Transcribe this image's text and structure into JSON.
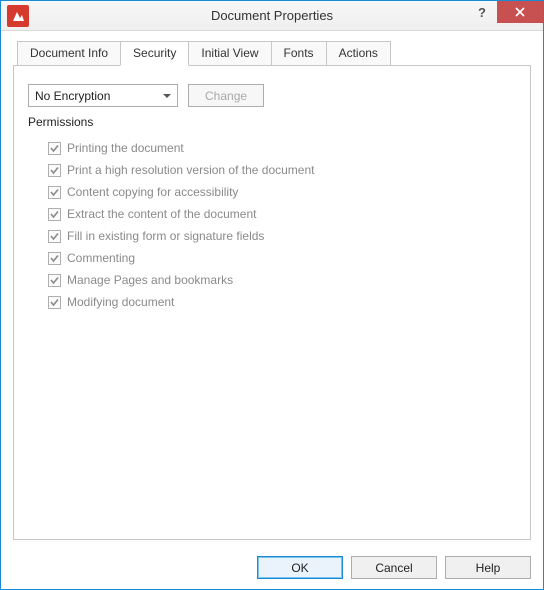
{
  "window": {
    "title": "Document Properties"
  },
  "tabs": {
    "items": [
      {
        "label": "Document Info"
      },
      {
        "label": "Security"
      },
      {
        "label": "Initial View"
      },
      {
        "label": "Fonts"
      },
      {
        "label": "Actions"
      }
    ],
    "active_index": 1
  },
  "security": {
    "encryption_selected": "No Encryption",
    "change_button": "Change",
    "permissions_label": "Permissions",
    "permissions": [
      {
        "label": "Printing the document",
        "checked": true
      },
      {
        "label": "Print a high resolution version of the document",
        "checked": true
      },
      {
        "label": "Content copying for accessibility",
        "checked": true
      },
      {
        "label": "Extract the content of the document",
        "checked": true
      },
      {
        "label": "Fill in existing form or signature fields",
        "checked": true
      },
      {
        "label": "Commenting",
        "checked": true
      },
      {
        "label": "Manage Pages and bookmarks",
        "checked": true
      },
      {
        "label": "Modifying document",
        "checked": true
      }
    ]
  },
  "footer": {
    "ok": "OK",
    "cancel": "Cancel",
    "help": "Help"
  }
}
